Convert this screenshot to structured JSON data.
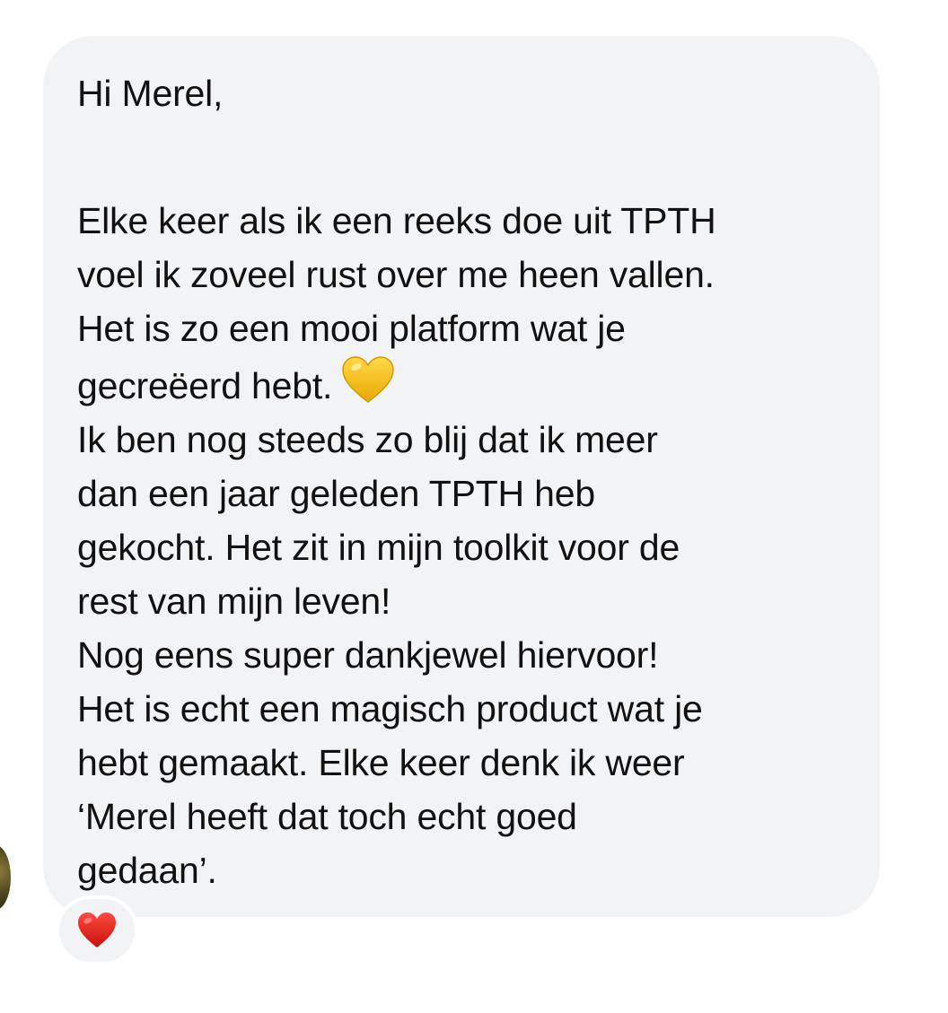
{
  "message": {
    "greeting": "Hi Merel,",
    "lines_block_1": [
      "Elke keer als ik een reeks doe uit TPTH",
      "voel ik zoveel rust over me heen vallen.",
      "Het is zo een mooi platform wat je",
      "gecreëerd hebt."
    ],
    "inline_emoji": "yellow-heart",
    "lines_block_2": [
      "Ik ben nog steeds zo blij dat ik meer",
      "dan een jaar geleden TPTH heb",
      "gekocht. Het zit in mijn toolkit voor de",
      "rest van mijn leven!"
    ],
    "lines_block_3": [
      "Nog eens super dankjewel hiervoor!",
      "Het is echt een magisch product wat je",
      "hebt gemaakt. Elke keer denk ik weer",
      "‘Merel heeft dat toch echt goed",
      "gedaan’."
    ]
  },
  "reaction": {
    "emoji": "red-heart"
  },
  "colors": {
    "bubble_background": "#f2f3f5",
    "text": "#111111",
    "yellow_heart": "#f5c21c",
    "red_heart": "#e0201c"
  }
}
